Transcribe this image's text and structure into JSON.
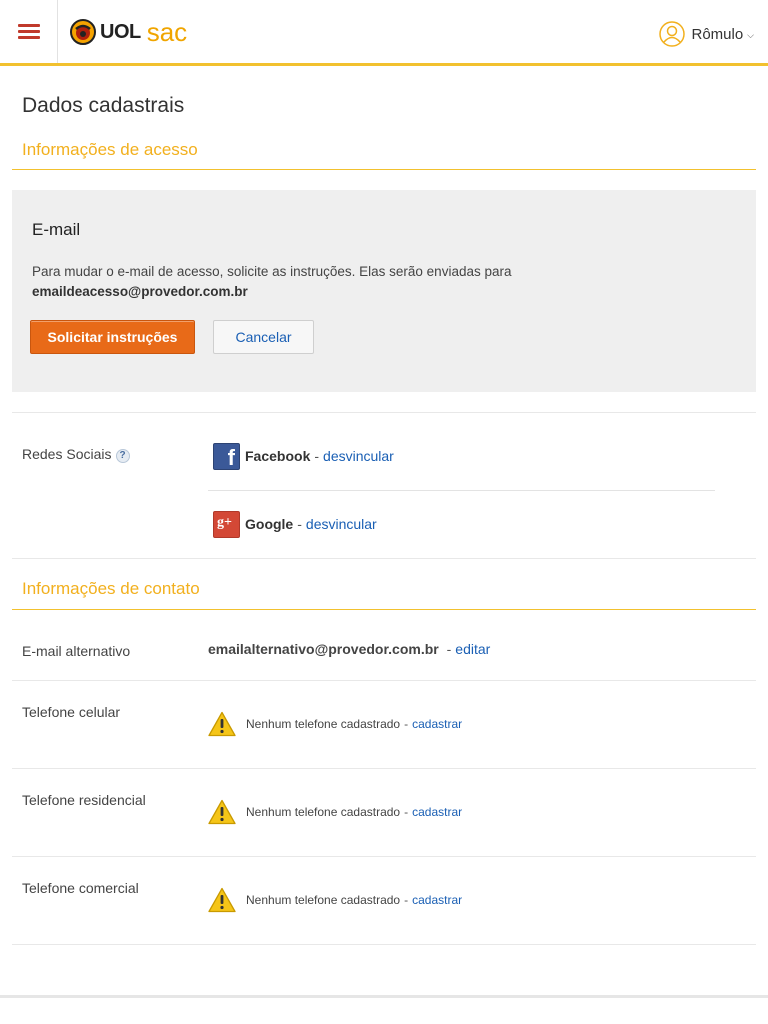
{
  "header": {
    "logo_uol": "UOL",
    "logo_sac": "sac",
    "user_name": "Rômulo"
  },
  "page": {
    "title": "Dados cadastrais"
  },
  "access": {
    "section_title": "Informações de acesso",
    "email_heading": "E-mail",
    "email_description": "Para mudar o e-mail de acesso, solicite as instruções. Elas serão enviadas para",
    "email_address": "emaildeacesso@provedor.com.br",
    "request_button": "Solicitar instruções",
    "cancel_button": "Cancelar"
  },
  "social": {
    "label": "Redes Sociais",
    "help": "?",
    "separator": "-",
    "items": [
      {
        "name": "Facebook",
        "action": "desvincular",
        "icon": "facebook-icon"
      },
      {
        "name": "Google",
        "action": "desvincular",
        "icon": "google-plus-icon"
      }
    ]
  },
  "contact": {
    "section_title": "Informações de contato",
    "alt_email_label": "E-mail alternativo",
    "alt_email_value": "emailalternativo@provedor.com.br",
    "alt_email_action": "editar",
    "phones": [
      {
        "label": "Telefone celular",
        "status": "Nenhum telefone cadastrado",
        "action": "cadastrar"
      },
      {
        "label": "Telefone residencial",
        "status": "Nenhum telefone cadastrado",
        "action": "cadastrar"
      },
      {
        "label": "Telefone comercial",
        "status": "Nenhum telefone cadastrado",
        "action": "cadastrar"
      }
    ]
  },
  "colors": {
    "accent_yellow": "#f2c12e",
    "section_title": "#f2b01e",
    "primary_button": "#e86a18",
    "link": "#1a5fb4",
    "menu_icon": "#c0392b"
  }
}
